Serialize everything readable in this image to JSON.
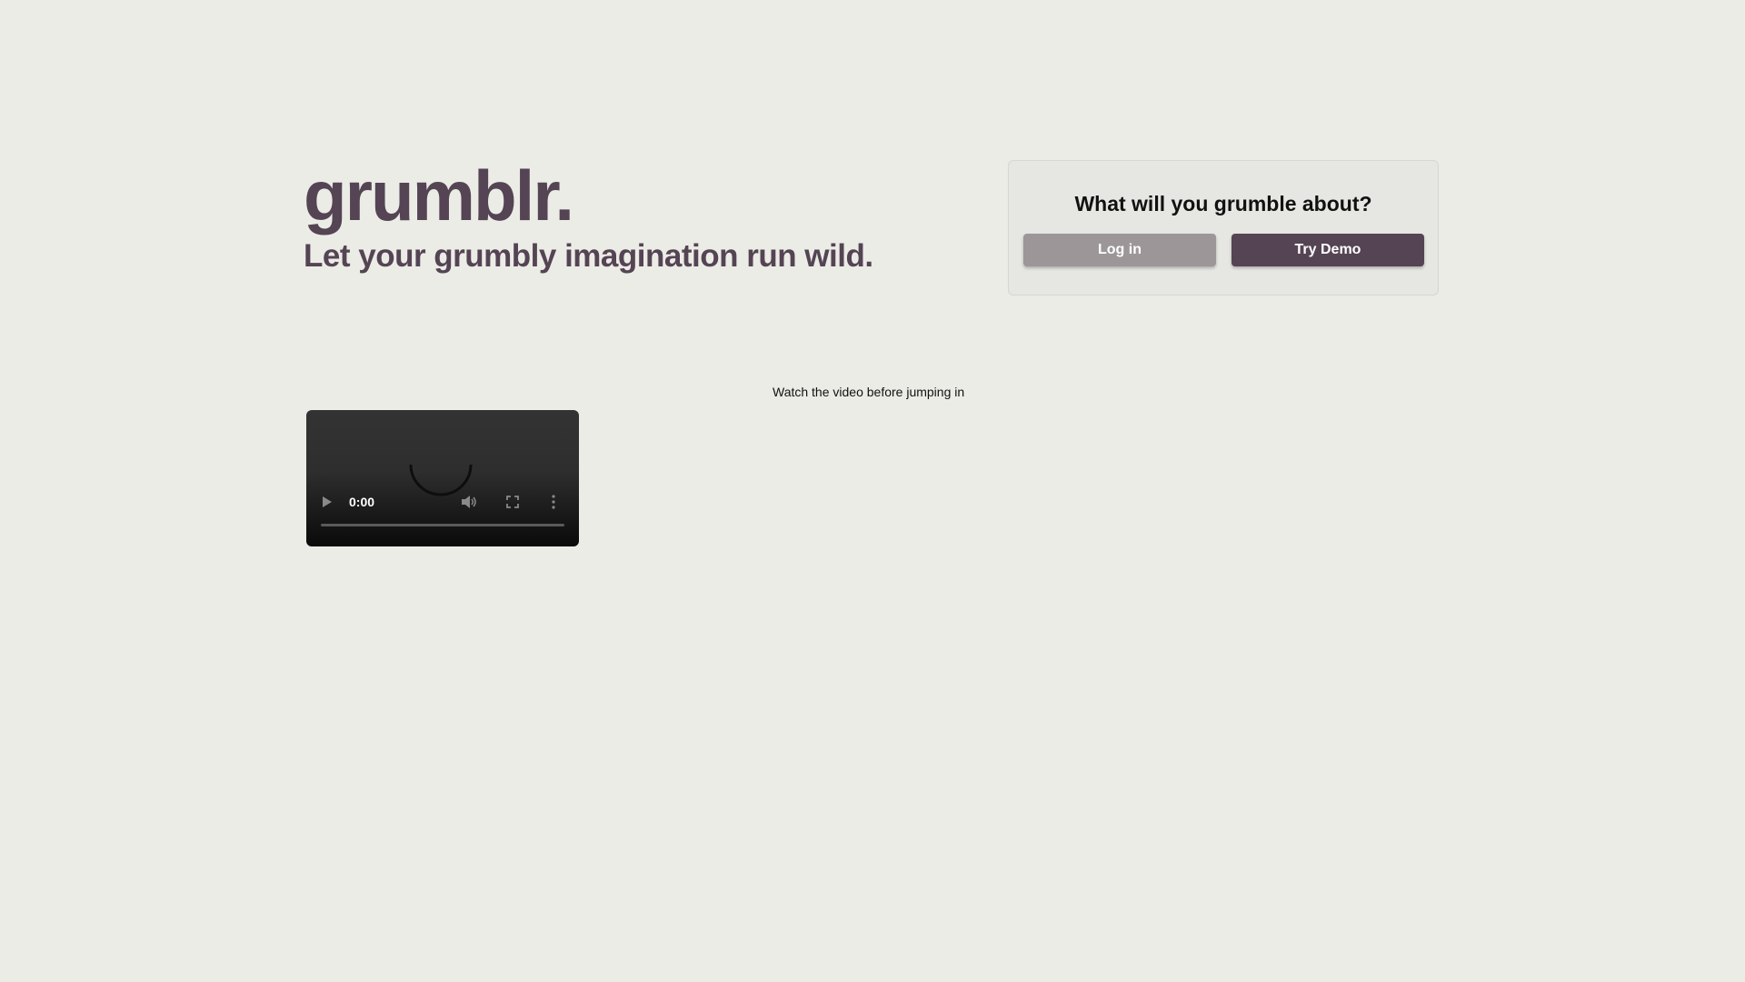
{
  "brand": {
    "logo": "grumblr.",
    "tagline": "Let your grumbly imagination run wild."
  },
  "auth": {
    "title": "What will you grumble about?",
    "login_label": "Log in",
    "demo_label": "Try Demo"
  },
  "video": {
    "caption": "Watch the video before jumping in",
    "current_time": "0:00",
    "progress_fraction": 0,
    "state": "loading"
  },
  "colors": {
    "background": "#ebece6",
    "brand": "#554454",
    "login_button": "#9c9699",
    "demo_button": "#554454"
  },
  "icons": {
    "play": "play-icon",
    "volume": "volume-icon",
    "fullscreen": "fullscreen-icon",
    "more": "more-vert-icon",
    "spinner": "loading-spinner-icon"
  }
}
